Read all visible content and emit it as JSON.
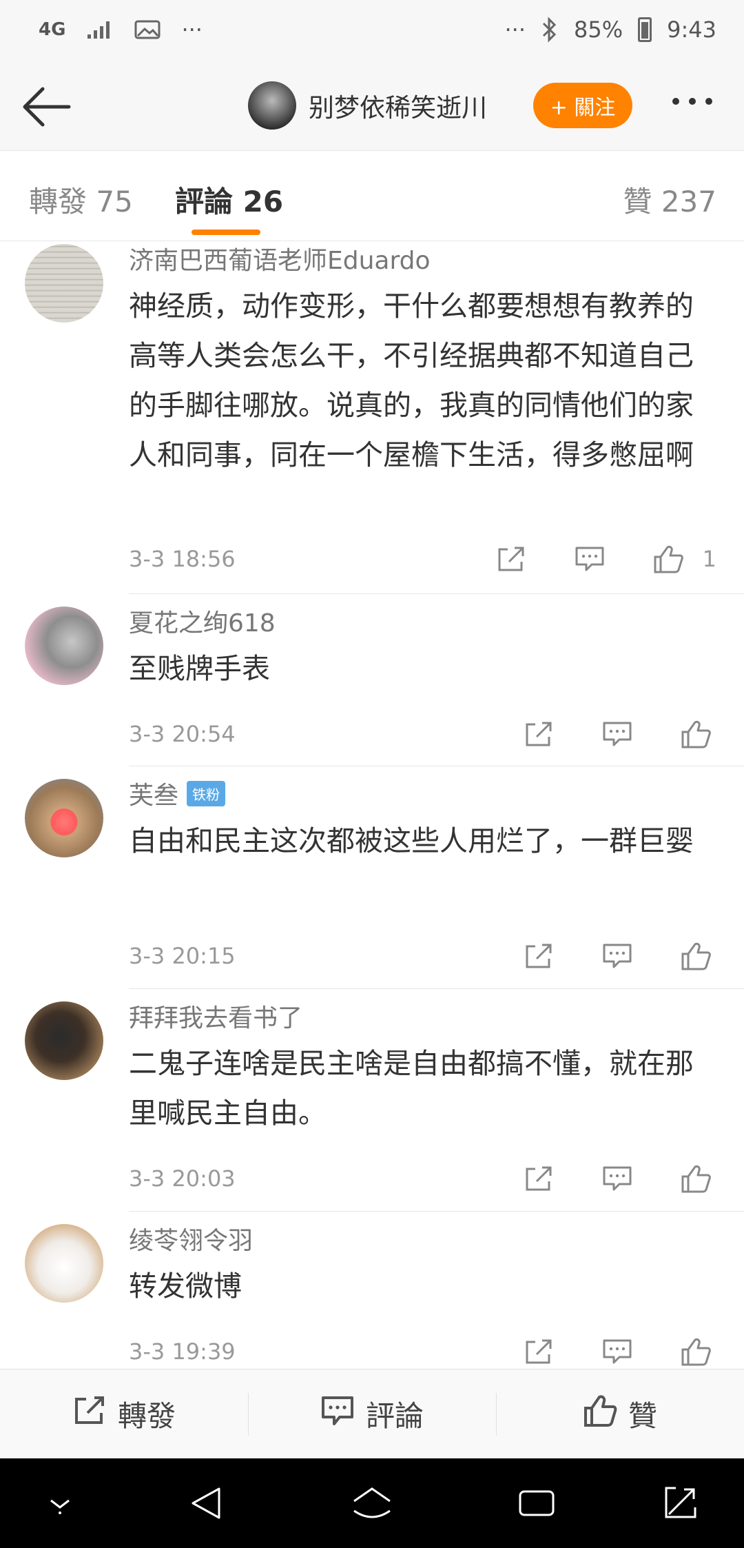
{
  "status_bar": {
    "network": "4G",
    "battery": "85%",
    "time": "9:43",
    "dots_left": "···",
    "dots_right": "···"
  },
  "header": {
    "username": "别梦依稀笑逝川",
    "follow_label": "+ 關注"
  },
  "tabs": [
    {
      "label": "轉發 75"
    },
    {
      "label": "評論 26"
    },
    {
      "label": "贊 237"
    }
  ],
  "comments": [
    {
      "user": "济南巴西葡语老师Eduardo",
      "text": "神经质，动作变形，干什么都要想想有教养的高等人类会怎么干，不引经据典都不知道自己的手脚往哪放。说真的，我真的同情他们的家人和同事，同在一个屋檐下生活，得多憋屈啊",
      "time": "3-3 18:56",
      "likes": "1"
    },
    {
      "user": "夏花之绚618",
      "text": "至贱牌手表",
      "time": "3-3 20:54",
      "likes": ""
    },
    {
      "user": "芙叁",
      "badge": "铁粉",
      "text": "自由和民主这次都被这些人用烂了，一群巨婴",
      "time": "3-3 20:15",
      "likes": ""
    },
    {
      "user": "拜拜我去看书了",
      "text": "二鬼子连啥是民主啥是自由都搞不懂，就在那里喊民主自由。",
      "time": "3-3 20:03",
      "likes": ""
    },
    {
      "user": "绫苓翎令羽",
      "text": "转发微博",
      "time": "3-3 19:39",
      "likes": ""
    }
  ],
  "bottom_bar": {
    "repost": "轉發",
    "comment": "評論",
    "like": "贊"
  },
  "colors": {
    "accent": "#ff8200",
    "badge": "#5aa9e6"
  }
}
